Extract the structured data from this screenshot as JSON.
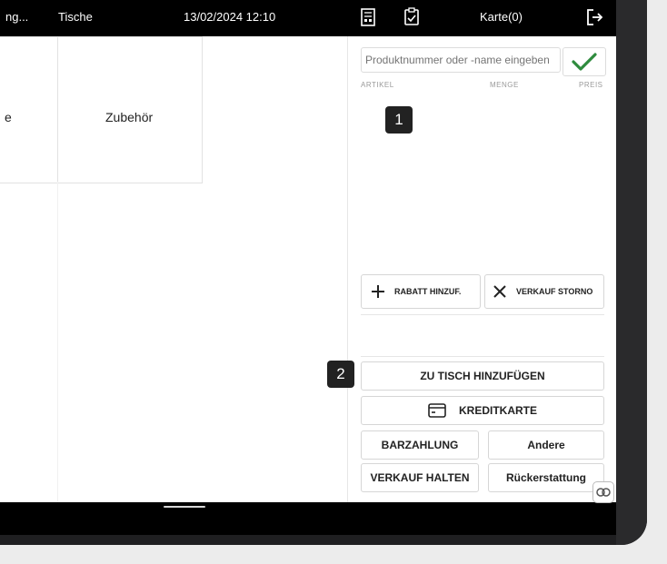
{
  "topbar": {
    "truncated_left": "ng...",
    "tables_label": "Tische",
    "datetime": "13/02/2024 12:10",
    "cart_label": "Karte(0)"
  },
  "tiles": {
    "left_partial_label": "e",
    "accessories_label": "Zubehör"
  },
  "search": {
    "placeholder": "Produktnummer oder -name eingeben"
  },
  "columns": {
    "article": "ARTIKEL",
    "quantity": "MENGE",
    "price": "PREIS"
  },
  "actions": {
    "add_discount": "RABATT HINZUF.",
    "cancel_sale": "VERKAUF STORNO",
    "add_to_table": "ZU TISCH HINZUFÜGEN",
    "credit_card": "KREDITKARTE",
    "cash": "BARZAHLUNG",
    "other": "Andere",
    "hold_sale": "VERKAUF HALTEN",
    "refund": "Rückerstattung"
  },
  "badges": {
    "first": "1",
    "second": "2"
  },
  "colors": {
    "check_green": "#2e8b3d",
    "topbar": "#000000"
  }
}
